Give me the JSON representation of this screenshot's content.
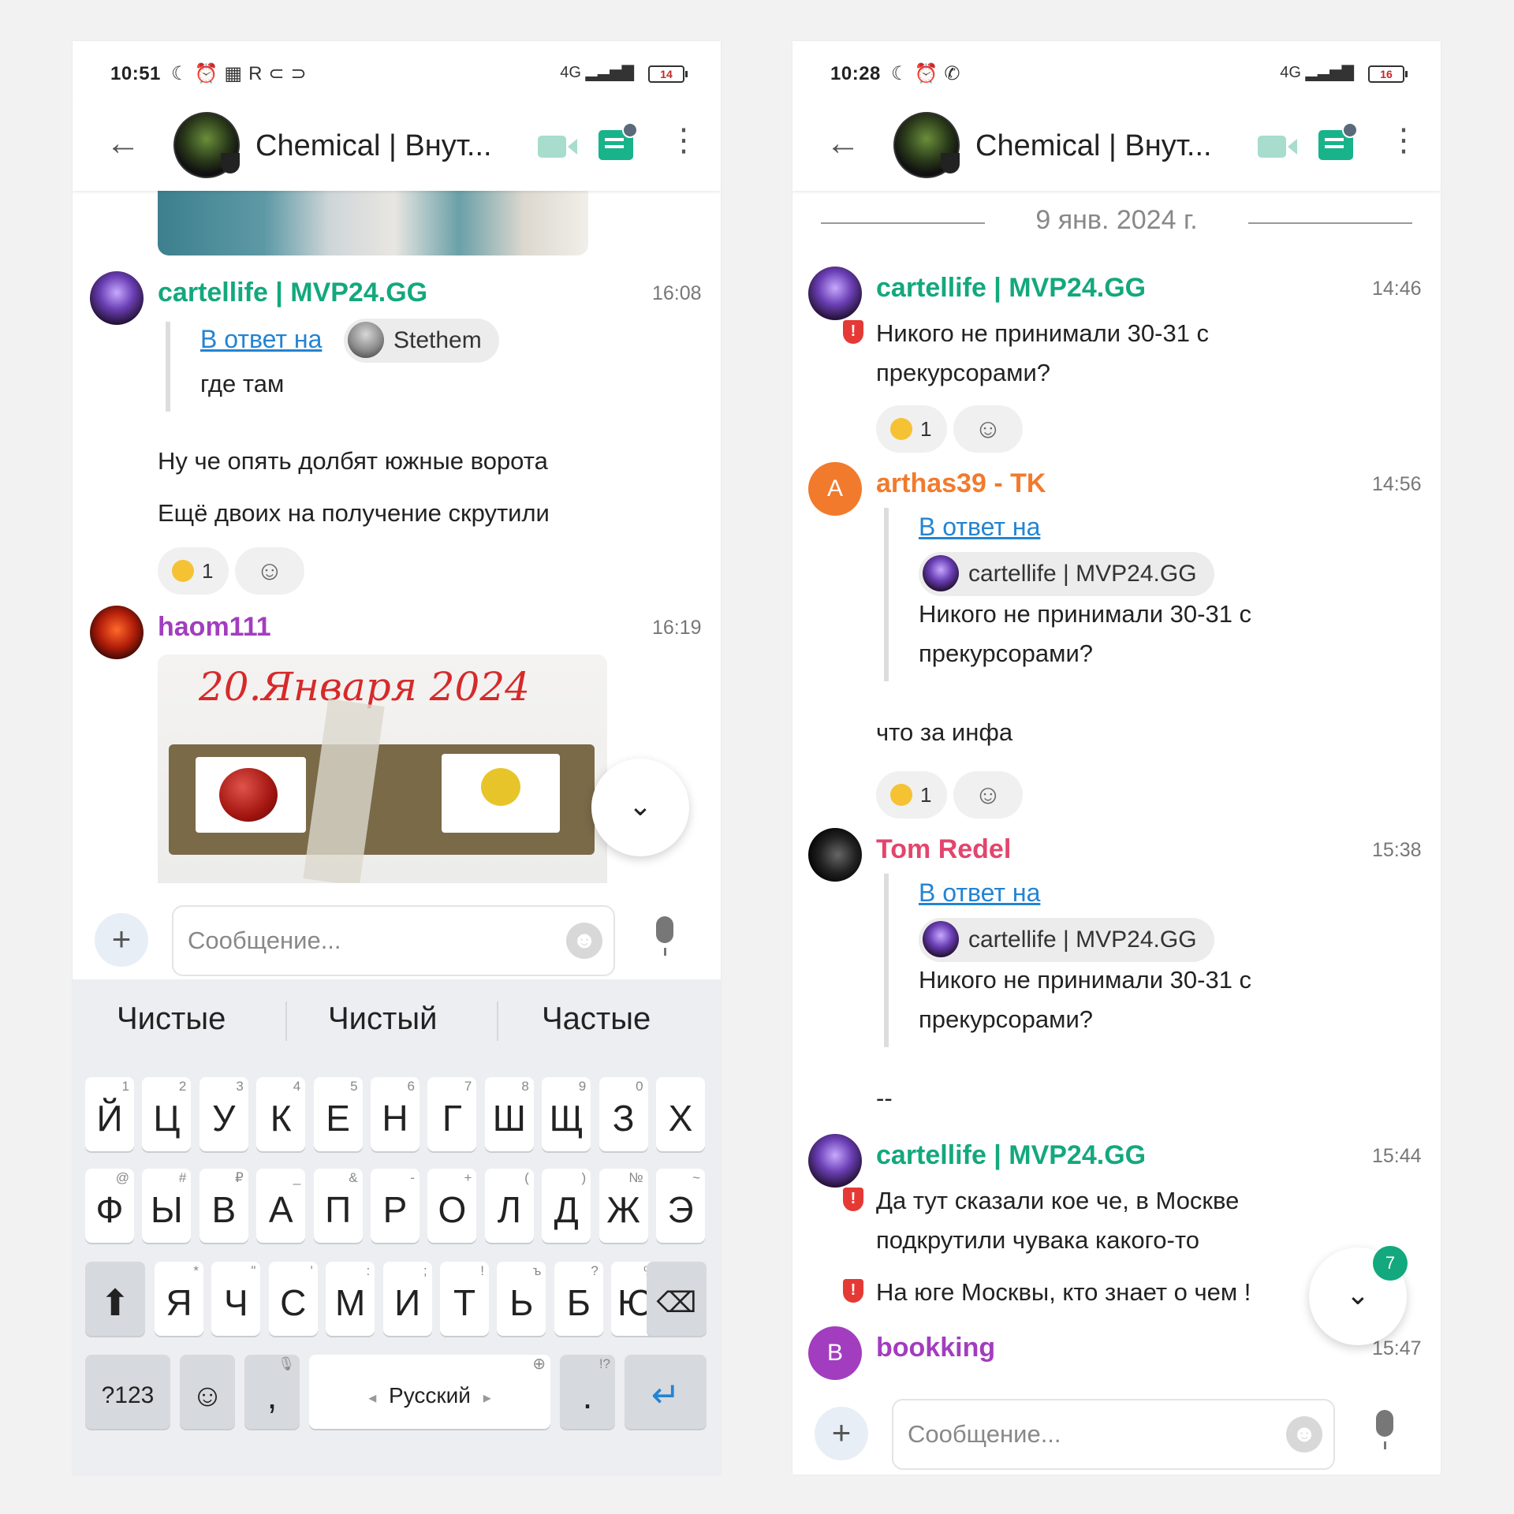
{
  "common": {
    "chat_title": "Chemical | Внут...",
    "composer_placeholder": "Сообщение...",
    "reply_label": "В ответ на"
  },
  "left": {
    "status": {
      "time": "10:51",
      "battery": "14"
    },
    "messages": [
      {
        "author": "cartellife | MVP24.GG",
        "time": "16:08",
        "reply_to": "Stethem",
        "reply_text": "где там",
        "lines": [
          "Ну че опять долбят южные ворота",
          "Ещё двоих на получение скрутили"
        ],
        "reaction_count": "1"
      },
      {
        "author": "haom111",
        "time": "16:19",
        "photo_caption": "20.Января 2024"
      }
    ],
    "suggestions": [
      "Чистые",
      "Чистый",
      "Частые"
    ],
    "keyboard": {
      "row1": [
        "Й",
        "Ц",
        "У",
        "К",
        "Е",
        "Н",
        "Г",
        "Ш",
        "Щ",
        "З",
        "Х"
      ],
      "row1_hints": [
        "1",
        "2",
        "3",
        "4",
        "5",
        "6",
        "7",
        "8",
        "9",
        "0",
        ""
      ],
      "row2": [
        "Ф",
        "Ы",
        "В",
        "А",
        "П",
        "Р",
        "О",
        "Л",
        "Д",
        "Ж",
        "Э"
      ],
      "row2_hints": [
        "@",
        "#",
        "₽",
        "_",
        "&",
        "-",
        "+",
        "(",
        ")",
        "№",
        "~"
      ],
      "row3": [
        "Я",
        "Ч",
        "С",
        "М",
        "И",
        "Т",
        "Ь",
        "Б",
        "Ю"
      ],
      "row3_hints": [
        "*",
        "\"",
        "'",
        ":",
        ";",
        "!",
        "ъ",
        "?",
        "%"
      ],
      "symbols": "?123",
      "comma": ",",
      "space": "Русский",
      "period": ".",
      "period_hint": "!?"
    }
  },
  "right": {
    "status": {
      "time": "10:28",
      "battery": "16"
    },
    "date": "9 янв. 2024 г.",
    "messages": [
      {
        "author": "cartellife | MVP24.GG",
        "time": "14:46",
        "lines": [
          "Никого не принимали 30-31 с",
          "прекурсорами?"
        ],
        "reaction_count": "1"
      },
      {
        "author": "arthas39 - TK",
        "initial": "A",
        "time": "14:56",
        "reply_to": "cartellife | MVP24.GG",
        "reply_lines": [
          "Никого не принимали 30-31 с",
          "прекурсорами?"
        ],
        "text": "что за инфа",
        "reaction_count": "1"
      },
      {
        "author": "Tom Redel",
        "time": "15:38",
        "reply_to": "cartellife | MVP24.GG",
        "reply_lines": [
          "Никого не принимали 30-31 с",
          "прекурсорами?"
        ],
        "text": "--"
      },
      {
        "author": "cartellife | MVP24.GG",
        "time": "15:44",
        "lines": [
          "Да тут сказали кое че, в Москве",
          "подкрутили чувака какого-то"
        ],
        "line2": "На юге Москвы, кто знает о чем !"
      },
      {
        "author": "bookking",
        "initial": "B",
        "time": "15:47"
      }
    ],
    "unread_badge": "7"
  }
}
